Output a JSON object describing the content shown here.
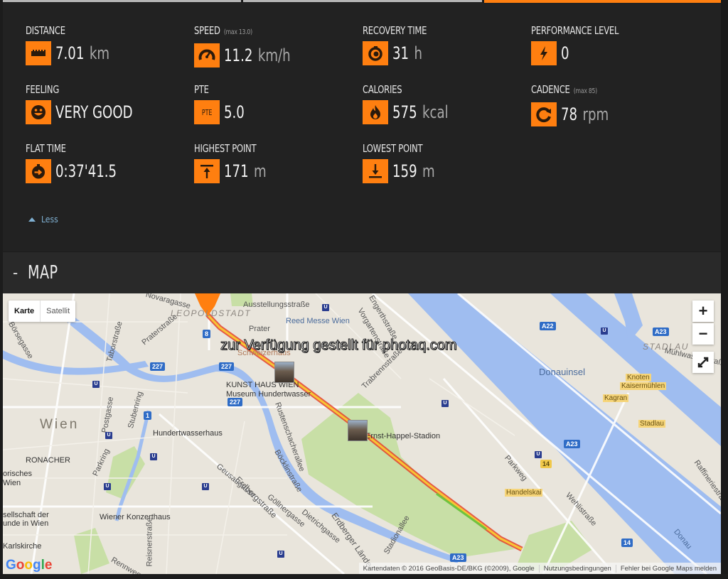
{
  "tabs": [
    {
      "label": ""
    },
    {
      "label": ""
    },
    {
      "label": "",
      "active": true
    }
  ],
  "colors": {
    "accent": "#ff7f10",
    "panel": "#222222",
    "link": "#7fb0d2"
  },
  "stats": [
    {
      "label": "DISTANCE",
      "value": "7.01",
      "unit": "km",
      "icon": "ruler-icon"
    },
    {
      "label": "SPEED",
      "max": "(max 13.0)",
      "value": "11.2",
      "unit": "km/h",
      "icon": "speedometer-icon"
    },
    {
      "label": "RECOVERY TIME",
      "value": "31",
      "unit": "h",
      "icon": "recovery-timer-icon"
    },
    {
      "label": "PERFORMANCE LEVEL",
      "value": "0",
      "unit": "",
      "icon": "lightning-icon"
    },
    {
      "label": "FEELING",
      "value": "VERY GOOD",
      "unit": "",
      "icon": "smiley-icon"
    },
    {
      "label": "PTE",
      "value": "5.0",
      "unit": "",
      "icon": "pte-icon",
      "icon_text": "PTE"
    },
    {
      "label": "CALORIES",
      "value": "575",
      "unit": "kcal",
      "icon": "flame-icon"
    },
    {
      "label": "CADENCE",
      "max": "(max 85)",
      "value": "78",
      "unit": "rpm",
      "icon": "cadence-icon"
    },
    {
      "label": "FLAT TIME",
      "value": "0:37'41.5",
      "unit": "",
      "icon": "stopwatch-arrow-icon"
    },
    {
      "label": "HIGHEST POINT",
      "value": "171",
      "unit": "m",
      "icon": "arrow-up-to-line-icon"
    },
    {
      "label": "LOWEST POINT",
      "value": "159",
      "unit": "m",
      "icon": "arrow-down-to-line-icon"
    }
  ],
  "less_label": "Less",
  "map_section": {
    "collapse_symbol": "-",
    "title": "MAP",
    "maptype": {
      "map": "Karte",
      "satellite": "Satellit"
    },
    "zoom_in": "+",
    "zoom_out": "−",
    "watermark": "zur Verfügung gestellt für photaq.com",
    "labels": {
      "leopoldstadt": "LEOPOLDSTADT",
      "ausstellungsstrasse": "Ausstellungsstraße",
      "reed_messe": "Reed Messe Wien",
      "prater": "Prater",
      "schweizerhaus": "Schweizerhaus",
      "kunsthaus": "KUNST HAUS WIEN",
      "museum": "Museum Hundertwasser",
      "wien": "Wien",
      "hundertwasserhaus": "Hundertwasserhaus",
      "ronacher": "RONACHER",
      "historisches": "orisches",
      "wien2": "Wien",
      "gesellschaft": "sellschaft der",
      "freunde": "unde in Wien",
      "konzerthaus": "Wiener Konzerthaus",
      "karlskirche": "Karlskirche",
      "stadion": "Ernst-Happel-Stadion",
      "donauinsel": "Donauinsel",
      "stadlau_district": "STADLAU",
      "muehlwasser": "Mühlwasserstraße",
      "knoten": "Knoten",
      "kaisermuehlen": "Kaisermühlen",
      "kagran": "Kagran",
      "stadlau": "Stadlau",
      "handelskai": "Handelskai",
      "parkweg": "Parkweg",
      "wehlistrasse": "Wehlistraße",
      "raffineriestrasse": "Raffineriestraße",
      "donau": "Donau",
      "boersegasse": "Börsegasse",
      "taborstrasse": "Taborstraße",
      "praterstrasse": "Praterstraße",
      "novaragasse": "Novaragasse",
      "postgasse": "Postgasse",
      "stubenring": "Stubenring",
      "parkring": "Parkring",
      "rustenschacherallee": "Rustenschacherallee",
      "boecklinstrasse": "Böcklinstraße",
      "geusaugasse": "Geusaugasse",
      "erdbergstrasse": "Erdbergstraße",
      "goellnergasse": "Göllnergasse",
      "dietrichgasse": "Dietrichgasse",
      "erdberger_laende": "Erdberger Lände",
      "stadionallee": "Stadionallee",
      "reisnerstrasse": "Reisnerstraße",
      "engerthstrasse": "Engerthstraße",
      "vorgartenstrasse": "Vorgartenstraße",
      "trabrennstrasse": "Trabrennstraße",
      "rennweg": "Rennweg"
    },
    "shields": {
      "r227": "227",
      "r1": "1",
      "r8": "8",
      "a22": "A22",
      "a23": "A23",
      "r14": "14"
    },
    "google_logo": "Google",
    "attribution": {
      "data": "Kartendaten © 2016 GeoBasis-DE/BKG (©2009), Google",
      "terms": "Nutzungsbedingungen",
      "report": "Fehler bei Google Maps melden"
    }
  }
}
